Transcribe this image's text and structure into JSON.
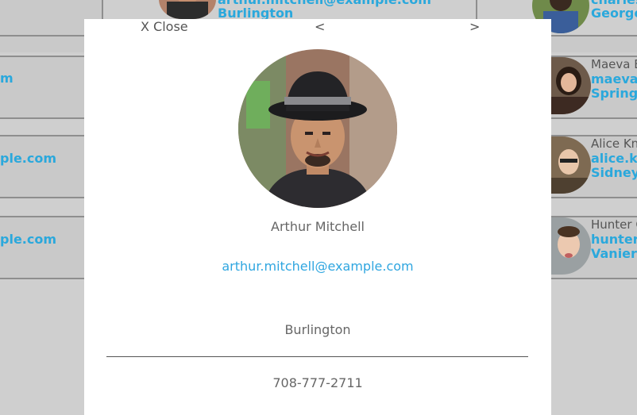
{
  "modal": {
    "close_label": "X Close",
    "prev_label": "<",
    "next_label": ">",
    "name": "Arthur Mitchell",
    "email": "arthur.mitchell@example.com",
    "city": "Burlington",
    "phone": "708-777-2711"
  },
  "background_cards": {
    "top_card": {
      "email": "arthur.mitchell@example.com",
      "city": "Burlington"
    },
    "top_right": {
      "email": "charles.",
      "city": "George"
    },
    "left": [
      {
        "email": "m"
      },
      {
        "email": "ple.com"
      },
      {
        "email": "ple.com"
      }
    ],
    "right": [
      {
        "name": "Maeva B",
        "email": "maeva.c",
        "city": "Springfi"
      },
      {
        "name": "Alice Kn",
        "email": "alice.kn",
        "city": "Sidney"
      },
      {
        "name": "Hunter C",
        "email": "hunter.",
        "city": "Vanier"
      }
    ]
  },
  "colors": {
    "link": "#2aa8dc",
    "overlay_bg": "#cfcfcf",
    "modal_bg": "#ffffff"
  }
}
